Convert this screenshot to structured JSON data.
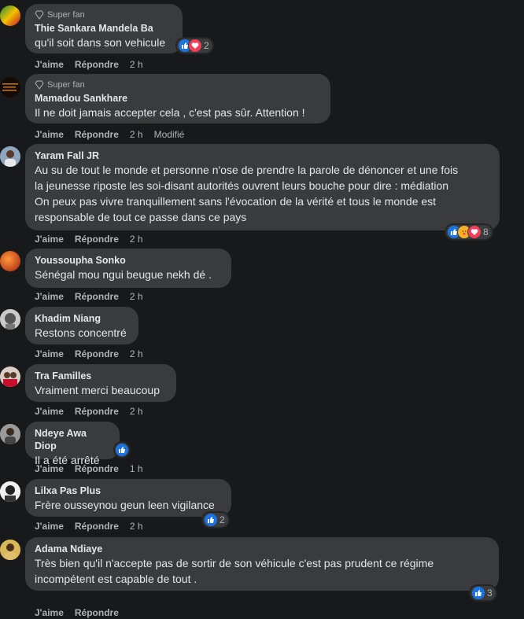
{
  "action_labels": {
    "like": "J'aime",
    "reply": "Répondre"
  },
  "super_fan_label": "Super fan",
  "comments": [
    {
      "author": "Thie Sankara Mandela Ba",
      "text": "qu'il soit dans son vehicule",
      "time": "2 h",
      "reaction_count": "2",
      "modified": ""
    },
    {
      "author": "Mamadou Sankhare",
      "text": "Il ne doit jamais accepter cela , c'est pas sûr. Attention !",
      "time": "2 h",
      "modified": "Modifié"
    },
    {
      "author": "Yaram Fall JR",
      "lines": [
        "Au su de tout le monde et personne n'ose de prendre la parole de dénoncer et une fois",
        "la jeunesse riposte les soi-disant autorités ouvrent leurs bouche pour dire : médiation",
        "On peux pas vivre tranquillement sans l'évocation de la vérité et tous le monde est",
        "responsable de tout ce passe dans ce pays"
      ],
      "time": "2 h",
      "reaction_count": "8"
    },
    {
      "author": "Youssoupha Sonko",
      "text": "Sénégal mou ngui beugue nekh dé .",
      "time": "2 h"
    },
    {
      "author": "Khadim Niang",
      "text": "Restons concentré",
      "time": "2 h"
    },
    {
      "author": "Tra Familles",
      "text": "Vraiment merci beaucoup",
      "time": "2 h"
    },
    {
      "author": "Ndeye Awa Diop",
      "text": "Il a été arrêté",
      "time": "1 h"
    },
    {
      "author": "Lilxa Pas Plus",
      "text": "Frère ousseynou geun leen vigilance",
      "time": "2 h",
      "reaction_count": "2"
    },
    {
      "author": "Adama Ndiaye",
      "lines": [
        "Très bien qu'il n'accepte pas de sortir de son véhicule c'est pas prudent ce régime",
        "incompétent est capable de tout ."
      ],
      "reaction_count": "3"
    }
  ],
  "colors": {
    "background": "#18191a",
    "bubble": "#3a3b3c",
    "like": "#1b74e4",
    "love": "#f33e58",
    "care": "#f7b125"
  }
}
